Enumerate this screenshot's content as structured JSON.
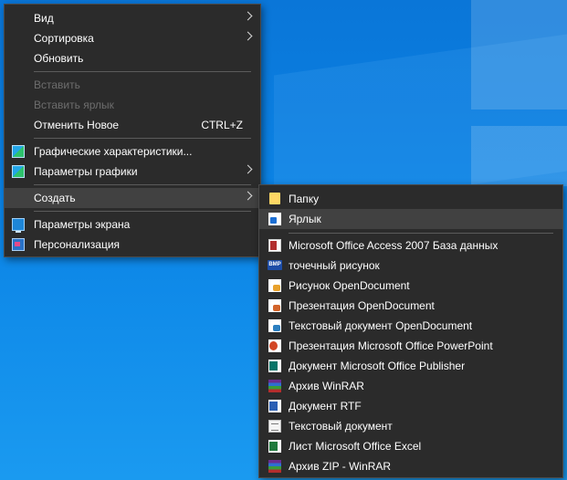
{
  "context_menu": {
    "items": [
      {
        "label": "Вид",
        "has_submenu": true
      },
      {
        "label": "Сортировка",
        "has_submenu": true
      },
      {
        "label": "Обновить"
      },
      {
        "label": "Вставить",
        "disabled": true
      },
      {
        "label": "Вставить ярлык",
        "disabled": true
      },
      {
        "label": "Отменить Новое",
        "shortcut": "CTRL+Z"
      },
      {
        "label": "Графические характеристики...",
        "icon": "graphics-monitor-icon"
      },
      {
        "label": "Параметры графики",
        "icon": "graphics-options-icon",
        "has_submenu": true
      },
      {
        "label": "Создать",
        "has_submenu": true,
        "selected": true
      },
      {
        "label": "Параметры экрана",
        "icon": "display-settings-icon"
      },
      {
        "label": "Персонализация",
        "icon": "personalization-icon"
      }
    ]
  },
  "create_submenu": {
    "items": [
      {
        "label": "Папку",
        "icon": "folder-icon"
      },
      {
        "label": "Ярлык",
        "icon": "shortcut-icon",
        "selected": true
      },
      {
        "label": "Microsoft Office Access 2007 База данных",
        "icon": "access-database-icon"
      },
      {
        "label": "точечный рисунок",
        "icon": "bitmap-icon",
        "icon_text": "BMP"
      },
      {
        "label": "Рисунок OpenDocument",
        "icon": "opendocument-drawing-icon"
      },
      {
        "label": "Презентация OpenDocument",
        "icon": "opendocument-presentation-icon"
      },
      {
        "label": "Текстовый документ OpenDocument",
        "icon": "opendocument-text-icon"
      },
      {
        "label": "Презентация Microsoft Office PowerPoint",
        "icon": "powerpoint-icon"
      },
      {
        "label": "Документ Microsoft Office Publisher",
        "icon": "publisher-icon"
      },
      {
        "label": "Архив WinRAR",
        "icon": "winrar-icon"
      },
      {
        "label": "Документ RTF",
        "icon": "rtf-document-icon"
      },
      {
        "label": "Текстовый документ",
        "icon": "text-document-icon"
      },
      {
        "label": "Лист Microsoft Office Excel",
        "icon": "excel-icon"
      },
      {
        "label": "Архив ZIP - WinRAR",
        "icon": "winrar-zip-icon"
      }
    ]
  },
  "colors": {
    "menu_background": "#2b2b2b",
    "menu_hover": "#414141",
    "text": "#ffffff",
    "disabled_text": "#6d6d6d",
    "desktop_blue": "#0b84e6"
  }
}
